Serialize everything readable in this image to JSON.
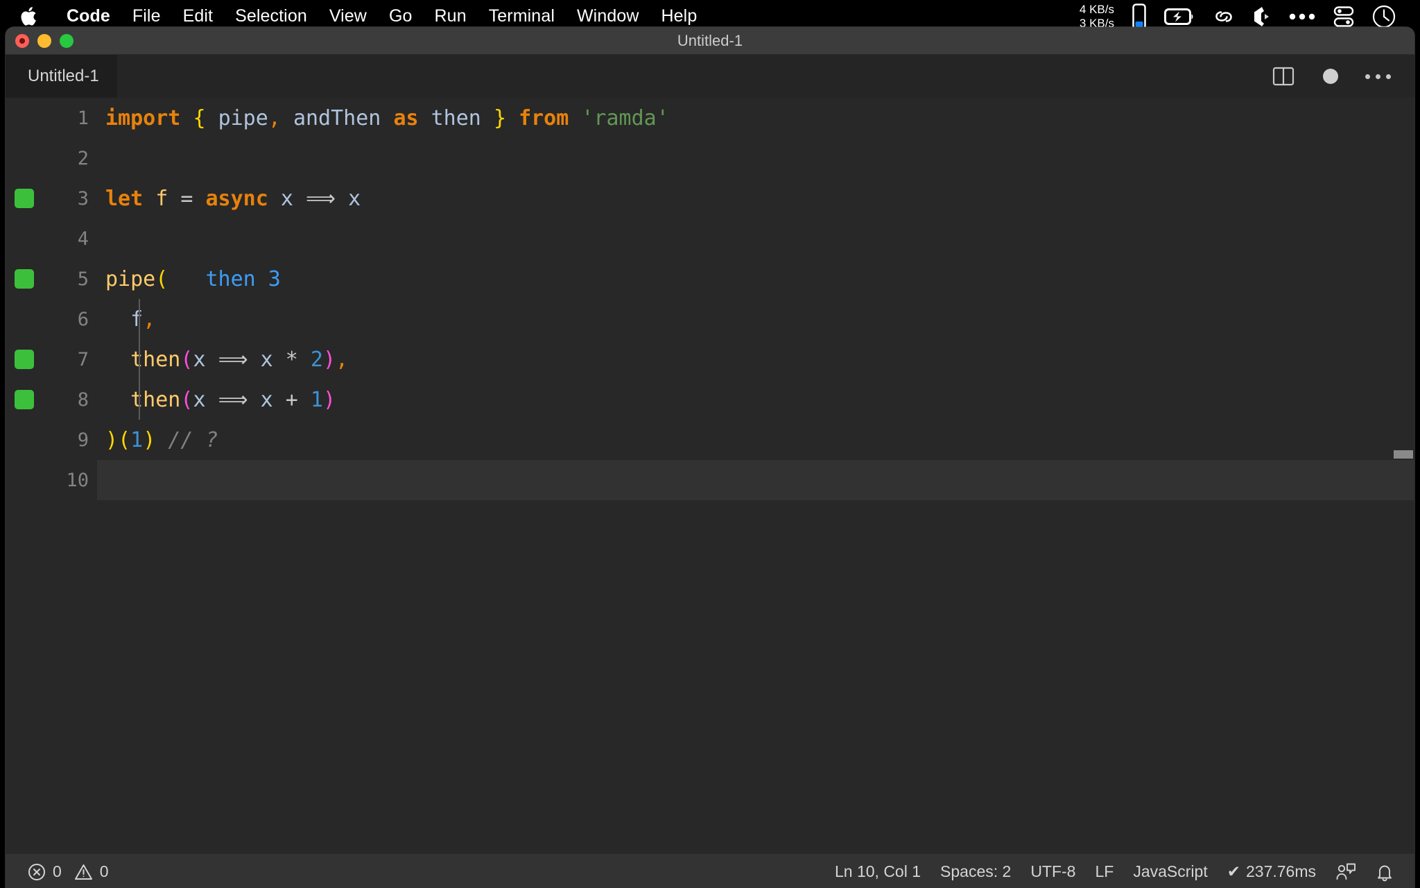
{
  "menubar": {
    "apple_icon": "apple-logo-icon",
    "items": [
      {
        "label": "Code",
        "bold": true
      },
      {
        "label": "File",
        "bold": false
      },
      {
        "label": "Edit",
        "bold": false
      },
      {
        "label": "Selection",
        "bold": false
      },
      {
        "label": "View",
        "bold": false
      },
      {
        "label": "Go",
        "bold": false
      },
      {
        "label": "Run",
        "bold": false
      },
      {
        "label": "Terminal",
        "bold": false
      },
      {
        "label": "Window",
        "bold": false
      },
      {
        "label": "Help",
        "bold": false
      }
    ],
    "tray": {
      "network_up": "4 KB/s",
      "network_down": "3 KB/s",
      "icons": [
        "battery-level-icon",
        "battery-charging-icon",
        "link-icon",
        "dropbox-icon",
        "ellipsis-icon",
        "control-center-icon",
        "clock-icon"
      ]
    }
  },
  "window": {
    "title": "Untitled-1",
    "traffic_lights": [
      "close-button",
      "minimize-button",
      "maximize-button"
    ]
  },
  "tabbar": {
    "active_tab": "Untitled-1",
    "actions": [
      "split-editor-icon",
      "unsaved-dot-icon",
      "more-actions-icon"
    ]
  },
  "editor": {
    "lines": [
      {
        "number": "1",
        "marker": false,
        "active": false,
        "indent_guide": false,
        "tokens": [
          {
            "text": "import",
            "cls": "t-kw"
          },
          {
            "text": " ",
            "cls": "t-op"
          },
          {
            "text": "{",
            "cls": "t-brace-y"
          },
          {
            "text": " ",
            "cls": "t-op"
          },
          {
            "text": "pipe",
            "cls": "t-var"
          },
          {
            "text": ",",
            "cls": "t-punc"
          },
          {
            "text": " ",
            "cls": "t-op"
          },
          {
            "text": "andThen",
            "cls": "t-var"
          },
          {
            "text": " ",
            "cls": "t-op"
          },
          {
            "text": "as",
            "cls": "t-kw"
          },
          {
            "text": " ",
            "cls": "t-op"
          },
          {
            "text": "then",
            "cls": "t-var"
          },
          {
            "text": " ",
            "cls": "t-op"
          },
          {
            "text": "}",
            "cls": "t-brace-y"
          },
          {
            "text": " ",
            "cls": "t-op"
          },
          {
            "text": "from",
            "cls": "t-kw"
          },
          {
            "text": " ",
            "cls": "t-op"
          },
          {
            "text": "'ramda'",
            "cls": "t-str"
          }
        ]
      },
      {
        "number": "2",
        "marker": false,
        "active": false,
        "indent_guide": false,
        "tokens": []
      },
      {
        "number": "3",
        "marker": true,
        "active": false,
        "indent_guide": false,
        "tokens": [
          {
            "text": "let",
            "cls": "t-kw"
          },
          {
            "text": " ",
            "cls": "t-op"
          },
          {
            "text": "f",
            "cls": "t-fn"
          },
          {
            "text": " ",
            "cls": "t-op"
          },
          {
            "text": "=",
            "cls": "t-op"
          },
          {
            "text": " ",
            "cls": "t-op"
          },
          {
            "text": "async",
            "cls": "t-kw"
          },
          {
            "text": " ",
            "cls": "t-op"
          },
          {
            "text": "x",
            "cls": "t-var"
          },
          {
            "text": " ",
            "cls": "t-op"
          },
          {
            "text": "⟹",
            "cls": "t-op"
          },
          {
            "text": " ",
            "cls": "t-op"
          },
          {
            "text": "x",
            "cls": "t-var"
          }
        ]
      },
      {
        "number": "4",
        "marker": false,
        "active": false,
        "indent_guide": false,
        "tokens": []
      },
      {
        "number": "5",
        "marker": true,
        "active": false,
        "indent_guide": false,
        "tokens": [
          {
            "text": "pipe",
            "cls": "t-fn"
          },
          {
            "text": "(",
            "cls": "t-brace-y"
          },
          {
            "text": "   ",
            "cls": "t-op"
          },
          {
            "text": "then 3",
            "cls": "t-hint"
          }
        ]
      },
      {
        "number": "6",
        "marker": false,
        "active": false,
        "indent_guide": true,
        "tokens": [
          {
            "text": "  ",
            "cls": "t-op"
          },
          {
            "text": "f",
            "cls": "t-var"
          },
          {
            "text": ",",
            "cls": "t-punc"
          }
        ]
      },
      {
        "number": "7",
        "marker": true,
        "active": false,
        "indent_guide": true,
        "tokens": [
          {
            "text": "  ",
            "cls": "t-op"
          },
          {
            "text": "then",
            "cls": "t-fn"
          },
          {
            "text": "(",
            "cls": "t-brace-m"
          },
          {
            "text": "x",
            "cls": "t-var"
          },
          {
            "text": " ",
            "cls": "t-op"
          },
          {
            "text": "⟹",
            "cls": "t-op"
          },
          {
            "text": " ",
            "cls": "t-op"
          },
          {
            "text": "x",
            "cls": "t-var"
          },
          {
            "text": " ",
            "cls": "t-op"
          },
          {
            "text": "*",
            "cls": "t-op"
          },
          {
            "text": " ",
            "cls": "t-op"
          },
          {
            "text": "2",
            "cls": "t-num"
          },
          {
            "text": ")",
            "cls": "t-brace-m"
          },
          {
            "text": ",",
            "cls": "t-punc"
          }
        ]
      },
      {
        "number": "8",
        "marker": true,
        "active": false,
        "indent_guide": true,
        "tokens": [
          {
            "text": "  ",
            "cls": "t-op"
          },
          {
            "text": "then",
            "cls": "t-fn"
          },
          {
            "text": "(",
            "cls": "t-brace-m"
          },
          {
            "text": "x",
            "cls": "t-var"
          },
          {
            "text": " ",
            "cls": "t-op"
          },
          {
            "text": "⟹",
            "cls": "t-op"
          },
          {
            "text": " ",
            "cls": "t-op"
          },
          {
            "text": "x",
            "cls": "t-var"
          },
          {
            "text": " ",
            "cls": "t-op"
          },
          {
            "text": "+",
            "cls": "t-op"
          },
          {
            "text": " ",
            "cls": "t-op"
          },
          {
            "text": "1",
            "cls": "t-num"
          },
          {
            "text": ")",
            "cls": "t-brace-m"
          }
        ]
      },
      {
        "number": "9",
        "marker": false,
        "active": false,
        "indent_guide": false,
        "tokens": [
          {
            "text": ")",
            "cls": "t-brace-y"
          },
          {
            "text": "(",
            "cls": "t-brace-y"
          },
          {
            "text": "1",
            "cls": "t-num"
          },
          {
            "text": ")",
            "cls": "t-brace-y"
          },
          {
            "text": " ",
            "cls": "t-op"
          },
          {
            "text": "// ?",
            "cls": "t-comment"
          }
        ]
      },
      {
        "number": "10",
        "marker": false,
        "active": true,
        "indent_guide": false,
        "tokens": []
      }
    ]
  },
  "statusbar": {
    "errors": "0",
    "warnings": "0",
    "cursor_position": "Ln 10, Col 1",
    "indentation": "Spaces: 2",
    "encoding": "UTF-8",
    "eol": "LF",
    "language": "JavaScript",
    "run_time": "237.76ms",
    "run_check": "✔",
    "right_icons": [
      "feedback-icon",
      "notifications-bell-icon"
    ]
  },
  "colors": {
    "accent_green": "#3cc03c",
    "keyword_orange": "#e8820c",
    "bracket_yellow": "#ffd700",
    "bracket_magenta": "#ff4fd8",
    "string_green": "#629755",
    "number_blue": "#3d92d6",
    "hint_blue": "#3d9df6",
    "editor_bg": "#282828",
    "titlebar_bg": "#3c3c3c",
    "statusbar_bg": "#333333"
  }
}
